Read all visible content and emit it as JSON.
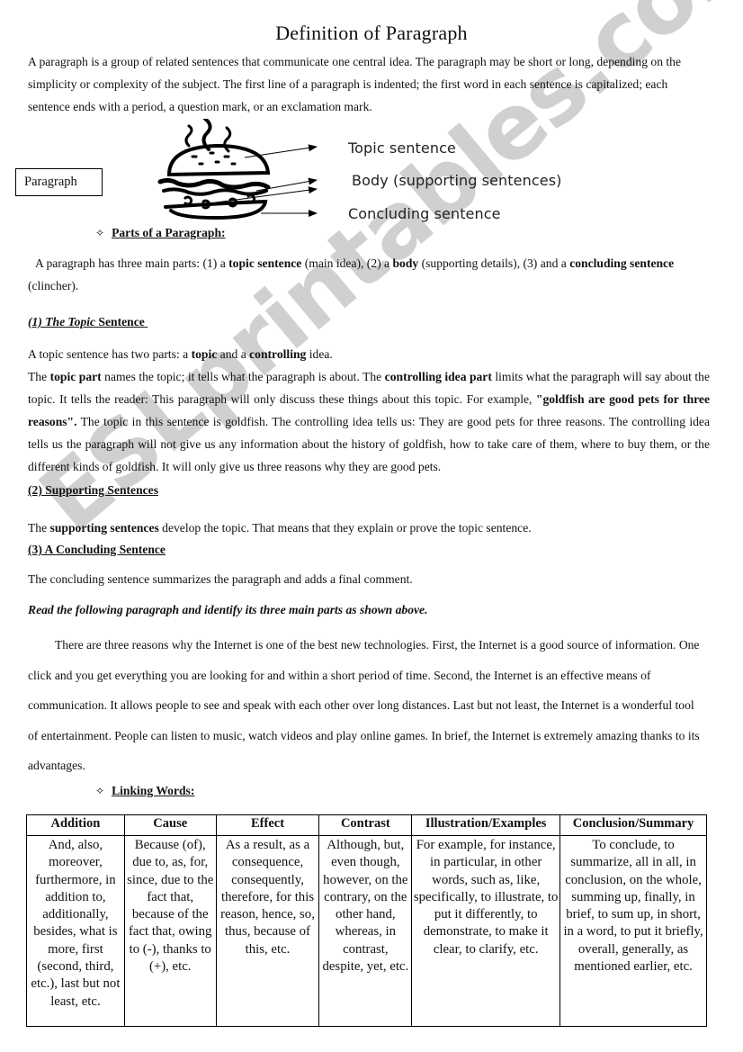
{
  "page": {
    "title": "Definition of Paragraph",
    "intro": "A paragraph is a group of related sentences that communicate one central idea. The paragraph may be short or long, depending on the simplicity or complexity of the subject. The first line of a paragraph is indented; the first word in each sentence is capitalized; each sentence ends with a period, a question mark, or an exclamation mark.",
    "watermark": "ESLprintables.com"
  },
  "diagram": {
    "box_label": "Paragraph",
    "icon": "burger-icon",
    "labels": {
      "topic": "Topic sentence",
      "body": "Body (supporting sentences)",
      "concluding": "Concluding sentence"
    }
  },
  "parts": {
    "bullet_icon": "four-dot-diamond-bullet",
    "heading": "Parts of a Paragraph:",
    "summary": {
      "t1": "A paragraph has three main parts: (1) a ",
      "b1": "topic sentence",
      "t2": " (main idea), (2) a ",
      "b2": "body",
      "t3": " (supporting details), (3) and a ",
      "b3": "concluding sentence",
      "t4": " (clincher)."
    }
  },
  "topic_section": {
    "heading_italic": "(1) The Topic",
    "heading_rest": " Sentence",
    "line1": {
      "t1": "A topic sentence has two parts: a ",
      "b1": "topic",
      "t2": " and a ",
      "b2": "controlling",
      "t3": " idea."
    },
    "line2": {
      "t1": "The ",
      "b1": "topic part",
      "t2": " names the topic; it tells what the paragraph is about. The ",
      "b2": "controlling idea part",
      "t3": " limits what the paragraph will say about the topic. It tells the reader: This paragraph will only discuss these things about this topic. For example, ",
      "b3": "\"goldfish are good pets for three reasons\".",
      "t4": " The topic in this sentence is goldfish. The controlling idea tells us: They are good pets for three reasons. The controlling idea tells us the paragraph will not give us any information about the history of goldfish, how to take care of them, where to buy them, or the different kinds of goldfish. It will only give us three reasons why they are good pets."
    }
  },
  "supporting_section": {
    "heading": "(2) Supporting Sentences",
    "text": {
      "t1": "The ",
      "b1": "supporting sentences",
      "t2": " develop the topic. That means that they explain or prove the topic sentence."
    }
  },
  "concluding_section": {
    "heading": "(3) A Concluding Sentence",
    "text": "The concluding sentence summarizes the paragraph and adds a final comment."
  },
  "exercise": {
    "instruction": "Read the following paragraph and identify its three main parts as shown above.",
    "paragraph": "There are three reasons why the Internet is one of the best new technologies. First, the Internet is a good source of information. One click and you get everything you are looking for and within a short period of time. Second, the Internet is an effective means of communication. It allows people to see and speak with each other over long distances. Last but not least, the Internet is a wonderful tool of entertainment. People can listen to music, watch videos and play online games. In brief, the Internet is extremely amazing thanks to its advantages."
  },
  "linking": {
    "heading": "Linking Words:",
    "columns": [
      {
        "header": "Addition",
        "words": "And, also, moreover, furthermore, in addition to, additionally, besides, what is more, first (second, third, etc.), last but not least, etc."
      },
      {
        "header": "Cause",
        "words": "Because (of), due to, as, for, since, due to the fact that, because of the fact that, owing to (-), thanks to (+), etc."
      },
      {
        "header": "Effect",
        "words": "As a result, as a consequence, consequently, therefore, for this reason, hence, so, thus, because of this, etc."
      },
      {
        "header": "Contrast",
        "words": "Although, but, even though, however, on the contrary, on the other hand, whereas, in contrast, despite, yet, etc."
      },
      {
        "header": "Illustration/Examples",
        "words": "For example, for instance, in particular, in other words, such as, like, specifically, to illustrate, to put it differently, to demonstrate, to make it clear, to clarify, etc."
      },
      {
        "header": "Conclusion/Summary",
        "words": "To conclude, to summarize, all in all, in conclusion, on the whole, summing up, finally, in brief, to sum up, in short, in a word, to put it briefly, overall, generally, as mentioned earlier, etc."
      }
    ]
  }
}
